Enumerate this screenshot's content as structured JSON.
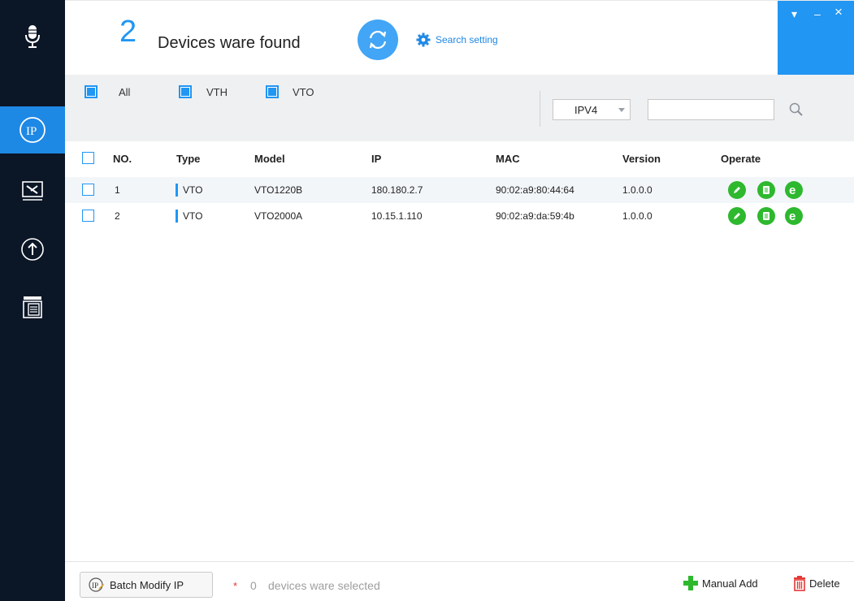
{
  "header": {
    "found_count": "2",
    "found_label": "Devices ware found",
    "search_setting": "Search setting"
  },
  "window_controls": {
    "menu": "▾",
    "minimize": "–",
    "close": "×"
  },
  "sidebar": {
    "items": [
      {
        "icon": "microphone-icon"
      },
      {
        "icon": "ip-icon",
        "active": true
      },
      {
        "icon": "tools-icon"
      },
      {
        "icon": "upgrade-icon"
      },
      {
        "icon": "document-list-icon"
      }
    ]
  },
  "filters": {
    "all": "All",
    "vth": "VTH",
    "vto": "VTO",
    "ip_version": "IPV4",
    "search_value": ""
  },
  "table": {
    "columns": {
      "no": "NO.",
      "type": "Type",
      "model": "Model",
      "ip": "IP",
      "mac": "MAC",
      "version": "Version",
      "operate": "Operate"
    },
    "rows": [
      {
        "no": "1",
        "type": "VTO",
        "model": "VTO1220B",
        "ip": "180.180.2.7",
        "mac": "90:02:a9:80:44:64",
        "version": "1.0.0.0"
      },
      {
        "no": "2",
        "type": "VTO",
        "model": "VTO2000A",
        "ip": "10.15.1.110",
        "mac": "90:02:a9:da:59:4b",
        "version": "1.0.0.0"
      }
    ]
  },
  "footer": {
    "batch_modify": "Batch Modify IP",
    "selected_star": "*",
    "selected_count": "0",
    "selected_text": "devices ware selected",
    "manual_add": "Manual Add",
    "delete": "Delete"
  },
  "colors": {
    "accent": "#2196f3",
    "sidebar_bg": "#0b1626",
    "operate_green": "#2eb82e",
    "delete_red": "#e53935"
  }
}
